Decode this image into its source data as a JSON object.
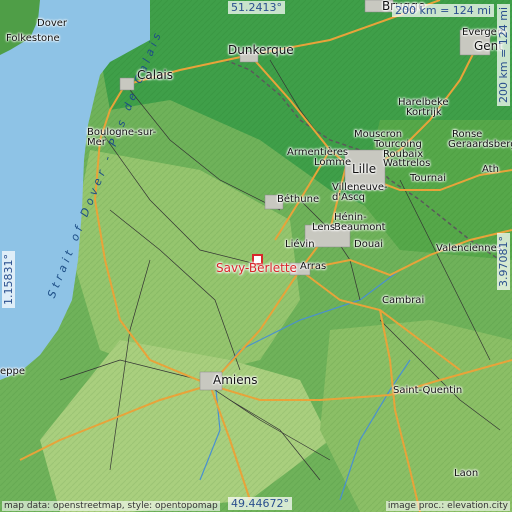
{
  "map": {
    "target": "Savy-Berlette",
    "coords": {
      "north": "51.2413°",
      "south": "49.44672°",
      "west": "1.15831°",
      "east": "3.97081°"
    },
    "scale": {
      "top": "200 km = 124 mi",
      "right": "200 km = 124 mi"
    },
    "sea_label": "Strait of Dover - Pas de Calais",
    "places": {
      "dover": "Dover",
      "folkestone": "Folkestone",
      "calais": "Calais",
      "dunkerque": "Dunkerque",
      "brugge": "Brugge",
      "evergem": "Evergem",
      "gent": "Gent",
      "harelbeke": "Harelbeke",
      "kortrijk": "Kortrijk",
      "mouscron": "Mouscron",
      "tourcoing": "Tourcoing",
      "roubaix": "Roubaix",
      "wattrelos": "Wattrelos",
      "ronse": "Ronse",
      "geraardsbergen": "Geraardsbergen",
      "ath": "Ath",
      "tournai": "Tournai",
      "boulogne": "Boulogne-sur-\nMer",
      "armentieres": "Armentières",
      "lomme": "Lomme",
      "lille": "Lille",
      "villeneuve": "Villeneuve-\nd'Ascq",
      "bethune": "Béthune",
      "henin": "Hénin-\nBeaumont",
      "lens": "Lens",
      "lievin": "Liévin",
      "douai": "Douai",
      "valenciennes": "Valenciennes",
      "arras": "Arras",
      "cambrai": "Cambrai",
      "amiens": "Amiens",
      "saint_quentin": "Saint-Quentin",
      "dieppe": "eppe",
      "laon": "Laon"
    },
    "attribution_left": "map data: openstreetmap, style: opentopomap",
    "attribution_right": "image proc.: elevation.city",
    "colors": {
      "sea": "#8ec3e6",
      "lowland": "#72b95d",
      "upland": "#a4c97a",
      "road_major": "#e8a33a",
      "road_minor": "#333333",
      "marker": "#d8262b"
    }
  }
}
